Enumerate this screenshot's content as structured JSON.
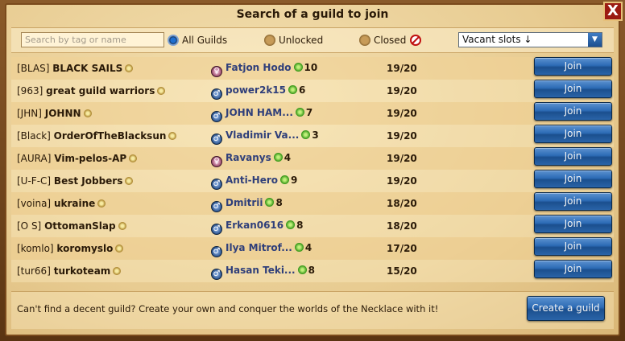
{
  "dialog": {
    "title": "Search of a guild to join",
    "close_label": "X"
  },
  "filters": {
    "search_placeholder": "Search by tag or name",
    "search_value": "",
    "radio_all": "All Guilds",
    "radio_unlocked": "Unlocked",
    "radio_closed": "Closed",
    "selected": "All Guilds",
    "sort_value": "Vacant slots ↓",
    "sort_arrow": "▼"
  },
  "guilds": [
    {
      "tag": "[BLAS]",
      "name": "BLACK SAILS",
      "leader": "Fatjon Hodo",
      "gender": "female",
      "level": "10",
      "slots": "19/20",
      "join": "Join"
    },
    {
      "tag": "[963]",
      "name": "great guild warriors",
      "leader": "power2k15",
      "gender": "male",
      "level": "6",
      "slots": "19/20",
      "join": "Join"
    },
    {
      "tag": "[JHN]",
      "name": "JOHNN",
      "leader": "JOHN HAM...",
      "gender": "male",
      "level": "7",
      "slots": "19/20",
      "join": "Join"
    },
    {
      "tag": "[Black]",
      "name": "OrderOfTheBlacksun",
      "leader": "Vladimir Va...",
      "gender": "male",
      "level": "3",
      "slots": "19/20",
      "join": "Join"
    },
    {
      "tag": "[AURA]",
      "name": "Vim-pelos-AP",
      "leader": "Ravanys",
      "gender": "female",
      "level": "4",
      "slots": "19/20",
      "join": "Join"
    },
    {
      "tag": "[U-F-C]",
      "name": "Best Jobbers",
      "leader": "Anti-Hero",
      "gender": "male",
      "level": "9",
      "slots": "19/20",
      "join": "Join"
    },
    {
      "tag": "[voina]",
      "name": "ukraine",
      "leader": "Dmitrii",
      "gender": "male",
      "level": "8",
      "slots": "18/20",
      "join": "Join"
    },
    {
      "tag": "[O S]",
      "name": "OttomanSlap",
      "leader": "Erkan0616",
      "gender": "male",
      "level": "8",
      "slots": "18/20",
      "join": "Join"
    },
    {
      "tag": "[komlo]",
      "name": "koromyslo",
      "leader": "Ilya Mitrof...",
      "gender": "male",
      "level": "4",
      "slots": "17/20",
      "join": "Join"
    },
    {
      "tag": "[tur66]",
      "name": "turkoteam",
      "leader": "Hasan Teki...",
      "gender": "male",
      "level": "8",
      "slots": "15/20",
      "join": "Join"
    }
  ],
  "footer": {
    "text": "Can't find a decent guild? Create your own and conquer the worlds of the Necklace with it!",
    "create_label": "Create a guild"
  }
}
